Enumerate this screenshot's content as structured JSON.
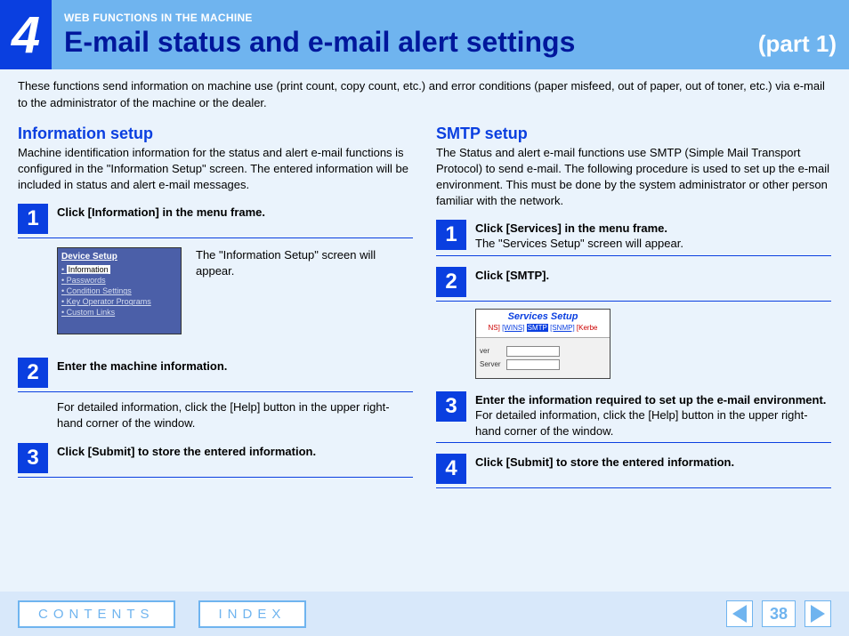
{
  "header": {
    "chapter_num": "4",
    "breadcrumb": "WEB FUNCTIONS IN THE MACHINE",
    "title": "E-mail status and e-mail alert settings",
    "part": "(part 1)"
  },
  "intro": "These functions send information on machine use (print count, copy count, etc.) and error conditions (paper misfeed, out of paper, out of toner, etc.) via e-mail to the administrator of the machine or the dealer.",
  "left": {
    "title": "Information setup",
    "desc": "Machine identification information for the status and alert e-mail functions is configured in the \"Information Setup\" screen. The entered information will be included in status and alert e-mail messages.",
    "steps": {
      "s1": {
        "num": "1",
        "title": "Click [Information] in the menu frame.",
        "caption": "The \"Information Setup\" screen will appear."
      },
      "s2": {
        "num": "2",
        "title": "Enter the machine information.",
        "body": "For detailed information, click the [Help] button in the upper right-hand corner of the window."
      },
      "s3": {
        "num": "3",
        "title": "Click [Submit] to store the entered information."
      }
    },
    "thumb1": {
      "title": "Device Setup",
      "items": [
        "Information",
        "Passwords",
        "Condition Settings",
        "Key Operator Programs",
        "Custom Links"
      ]
    }
  },
  "right": {
    "title": "SMTP setup",
    "desc": "The Status and alert e-mail functions use SMTP (Simple Mail Transport Protocol) to send e-mail. The following procedure is used to set up the e-mail environment. This must be done by the system administrator or other person familiar with the network.",
    "steps": {
      "s1": {
        "num": "1",
        "title": "Click [Services] in the menu frame.",
        "sub": "The \"Services Setup\" screen will appear."
      },
      "s2": {
        "num": "2",
        "title": "Click [SMTP]."
      },
      "s3": {
        "num": "3",
        "title": "Enter the information required to set up the e-mail environment.",
        "sub": "For detailed information, click the [Help] button in the upper right-hand corner of the window."
      },
      "s4": {
        "num": "4",
        "title": "Click [Submit] to store the entered information."
      }
    },
    "thumb2": {
      "title": "Services Setup",
      "links": {
        "ns": "NS]",
        "wins": "[WINS]",
        "smtp": "SMTP",
        "snmp": "[SNMP]",
        "kerb": "[Kerbe"
      },
      "rows": {
        "r1": "ver",
        "r2": "Server"
      }
    }
  },
  "footer": {
    "contents": "CONTENTS",
    "index": "INDEX",
    "page": "38"
  }
}
